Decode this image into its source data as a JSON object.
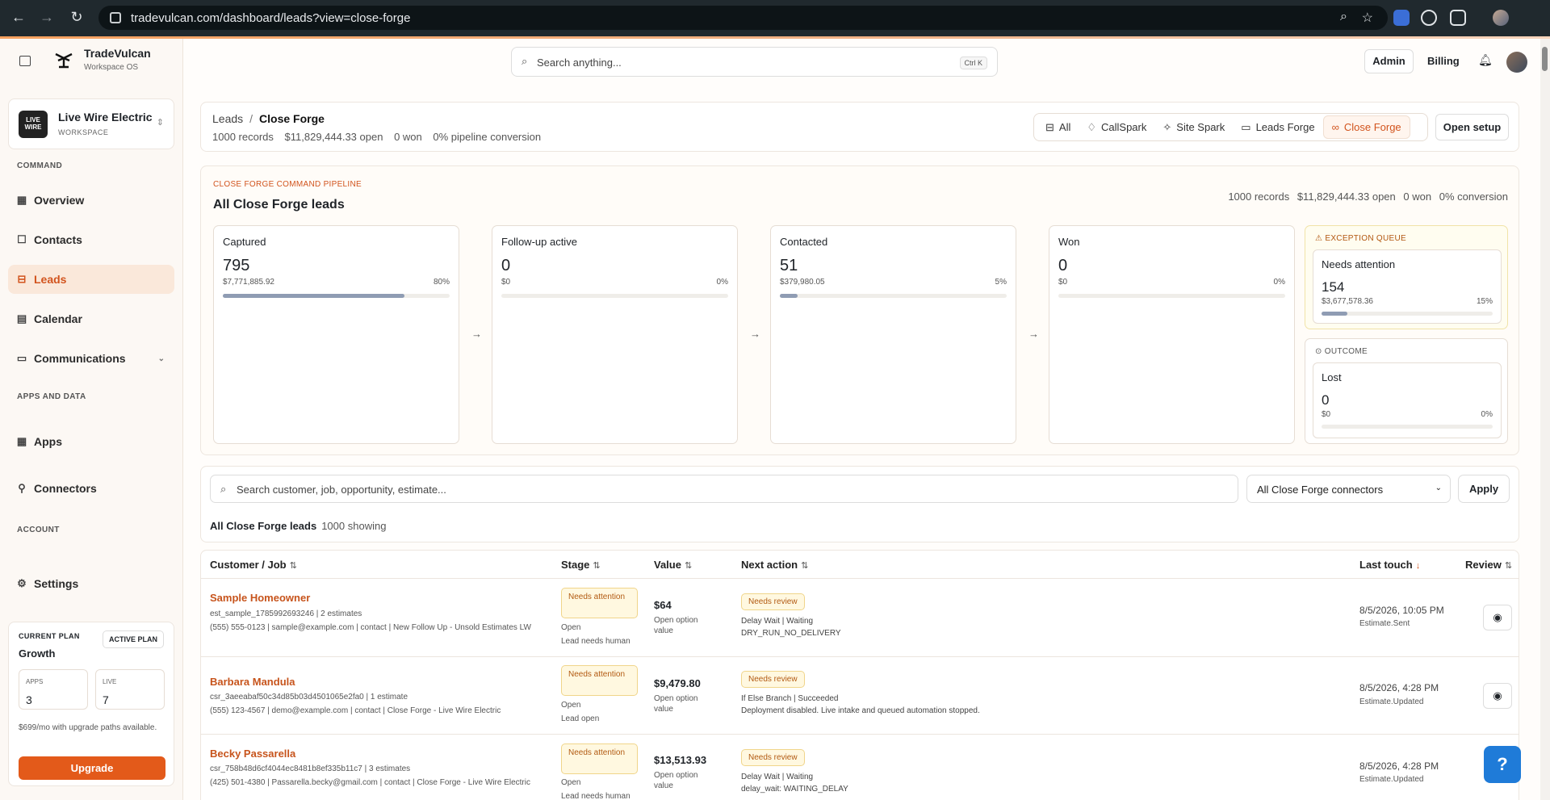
{
  "browser": {
    "url": "tradevulcan.com/dashboard/leads?view=close-forge"
  },
  "brand": {
    "name": "TradeVulcan",
    "subtitle": "Workspace OS"
  },
  "workspace": {
    "name": "Live Wire Electric",
    "type": "WORKSPACE",
    "logo_text": "LIVE WIRE"
  },
  "nav": {
    "command_label": "COMMAND",
    "items": [
      {
        "label": "Overview",
        "icon": "grid-icon"
      },
      {
        "label": "Contacts",
        "icon": "contacts-icon"
      },
      {
        "label": "Leads",
        "icon": "inbox-icon",
        "active": true
      },
      {
        "label": "Calendar",
        "icon": "calendar-icon"
      },
      {
        "label": "Communications",
        "icon": "chat-icon"
      }
    ],
    "apps_label": "APPS AND DATA",
    "apps_items": [
      {
        "label": "Apps",
        "icon": "grid-icon"
      },
      {
        "label": "Connectors",
        "icon": "plug-icon"
      }
    ],
    "account_label": "ACCOUNT",
    "account_items": [
      {
        "label": "Settings",
        "icon": "gear-icon"
      }
    ]
  },
  "plan": {
    "current_label": "CURRENT PLAN",
    "name": "Growth",
    "active_badge": "ACTIVE PLAN",
    "apps_label": "APPS",
    "apps_value": "3",
    "live_label": "LIVE",
    "live_value": "7",
    "price_text": "$699/mo with upgrade paths available.",
    "upgrade_label": "Upgrade"
  },
  "topbar": {
    "search_placeholder": "Search anything...",
    "search_shortcut": "Ctrl K",
    "admin_label": "Admin",
    "billing_label": "Billing"
  },
  "header": {
    "crumb_root": "Leads",
    "crumb_current": "Close Forge",
    "stats": [
      "1000 records",
      "$11,829,444.33 open",
      "0 won",
      "0% pipeline conversion"
    ],
    "filters": [
      {
        "label": "All",
        "icon": "inbox-icon"
      },
      {
        "label": "CallSpark",
        "icon": "bell-icon"
      },
      {
        "label": "Site Spark",
        "icon": "sparkle-icon"
      },
      {
        "label": "Leads Forge",
        "icon": "message-icon"
      },
      {
        "label": "Close Forge",
        "icon": "link-icon",
        "active": true
      }
    ],
    "setup_label": "Open setup"
  },
  "pipeline": {
    "label": "CLOSE FORGE COMMAND PIPELINE",
    "title": "All Close Forge leads",
    "stats": [
      "1000 records",
      "$11,829,444.33 open",
      "0 won",
      "0% conversion"
    ],
    "stages": [
      {
        "name": "Captured",
        "count": "795",
        "amount": "$7,771,885.92",
        "pct": "80%",
        "fill": 0.8
      },
      {
        "name": "Follow-up active",
        "count": "0",
        "amount": "$0",
        "pct": "0%",
        "fill": 0
      },
      {
        "name": "Contacted",
        "count": "51",
        "amount": "$379,980.05",
        "pct": "5%",
        "fill": 0.08
      },
      {
        "name": "Won",
        "count": "0",
        "amount": "$0",
        "pct": "0%",
        "fill": 0
      }
    ],
    "exception": {
      "label": "EXCEPTION QUEUE",
      "name": "Needs attention",
      "count": "154",
      "amount": "$3,677,578.36",
      "pct": "15%",
      "fill": 0.15
    },
    "outcome": {
      "label": "OUTCOME",
      "name": "Lost",
      "count": "0",
      "amount": "$0",
      "pct": "0%",
      "fill": 0
    }
  },
  "table": {
    "search_placeholder": "Search customer, job, opportunity, estimate...",
    "connector_select": "All Close Forge connectors",
    "apply_label": "Apply",
    "showing_title": "All Close Forge leads",
    "showing_count": "1000 showing",
    "columns": {
      "customer": "Customer / Job",
      "stage": "Stage",
      "value": "Value",
      "next": "Next action",
      "last": "Last touch",
      "review": "Review"
    },
    "rows": [
      {
        "name": "Sample Homeowner",
        "line1": "est_sample_1785992693246 | 2 estimates",
        "line2": "(555) 555-0123 | sample@example.com | contact | New Follow Up - Unsold Estimates LW",
        "stage_badge": "Needs attention",
        "stage_status": "Open",
        "stage_note": "Lead needs human",
        "value": "$64",
        "value_note": "Open option value",
        "next_badge": "Needs review",
        "next_line1": "Delay Wait | Waiting",
        "next_line2": "DRY_RUN_NO_DELIVERY",
        "last_time": "8/5/2026, 10:05 PM",
        "last_event": "Estimate.Sent"
      },
      {
        "name": "Barbara Mandula",
        "line1": "csr_3aeeabaf50c34d85b03d4501065e2fa0 | 1 estimate",
        "line2": "(555) 123-4567 | demo@example.com | contact | Close Forge - Live Wire Electric",
        "stage_badge": "Needs attention",
        "stage_status": "Open",
        "stage_note": "Lead open",
        "value": "$9,479.80",
        "value_note": "Open option value",
        "next_badge": "Needs review",
        "next_line1": "If Else Branch | Succeeded",
        "next_line2": "Deployment disabled. Live intake and queued automation stopped.",
        "last_time": "8/5/2026, 4:28 PM",
        "last_event": "Estimate.Updated"
      },
      {
        "name": "Becky Passarella",
        "line1": "csr_758b48d6cf4044ec8481b8ef335b11c7 | 3 estimates",
        "line2": "(425) 501-4380 | Passarella.becky@gmail.com | contact | Close Forge - Live Wire Electric",
        "stage_badge": "Needs attention",
        "stage_status": "Open",
        "stage_note": "Lead needs human",
        "value": "$13,513.93",
        "value_note": "Open option value",
        "next_badge": "Needs review",
        "next_line1": "Delay Wait | Waiting",
        "next_line2": "delay_wait: WAITING_DELAY",
        "last_time": "8/5/2026, 4:28 PM",
        "last_event": "Estimate.Updated"
      }
    ]
  },
  "help": {
    "label": "?"
  }
}
